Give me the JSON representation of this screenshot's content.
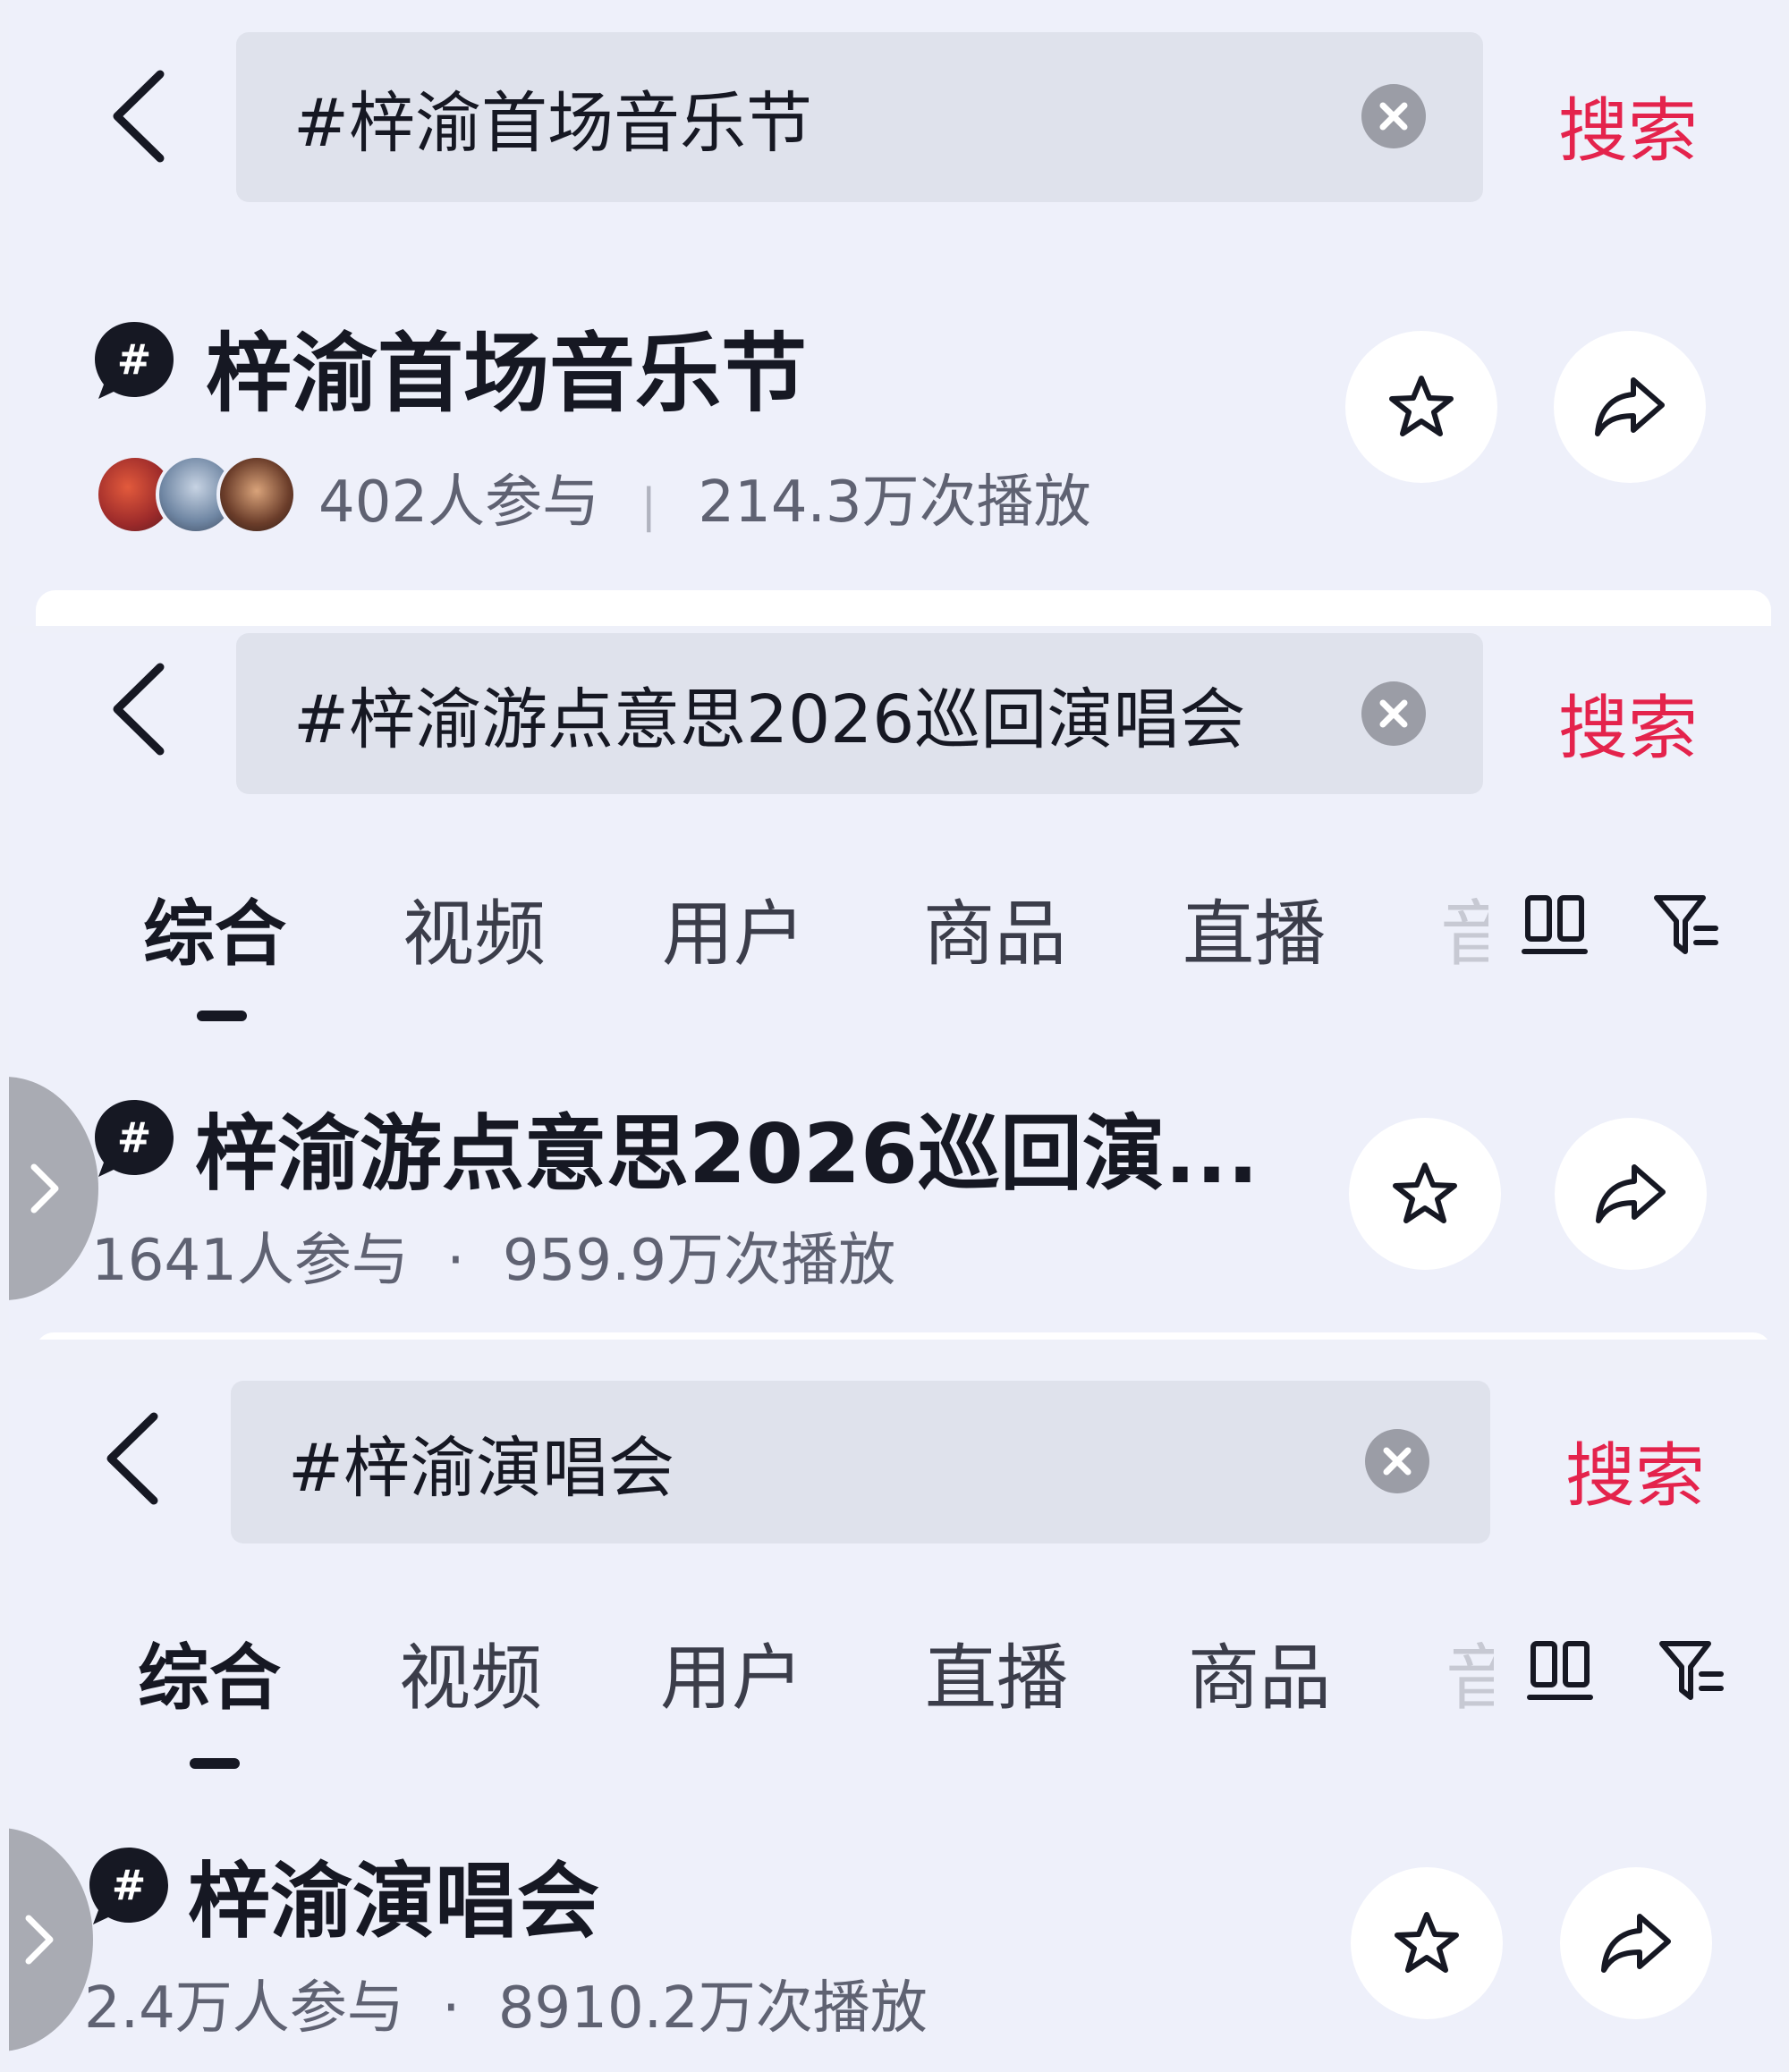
{
  "panels": [
    {
      "search_query": "#梓渝首场音乐节",
      "search_button": "搜索",
      "topic_title": "梓渝首场音乐节",
      "participants": "402人参与",
      "stat_separator": "|",
      "plays": "214.3万次播放"
    },
    {
      "search_query": "#梓渝游点意思2026巡回演唱会",
      "search_button": "搜索",
      "tabs": [
        "综合",
        "视频",
        "用户",
        "商品",
        "直播"
      ],
      "tab_partial": "音",
      "active_tab": "综合",
      "topic_title": "梓渝游点意思2026巡回演...",
      "participants": "1641人参与",
      "stat_separator": "·",
      "plays": "959.9万次播放"
    },
    {
      "search_query": "#梓渝演唱会",
      "search_button": "搜索",
      "tabs": [
        "综合",
        "视频",
        "用户",
        "直播",
        "商品"
      ],
      "tab_partial": "音",
      "active_tab": "综合",
      "topic_title": "梓渝演唱会",
      "participants": "2.4万人参与",
      "stat_separator": "·",
      "plays": "8910.2万次播放"
    }
  ],
  "colors": {
    "background": "#eef0fa",
    "search_accent": "#e4234c",
    "search_box": "#dfe2ec",
    "text_primary": "#161823",
    "text_secondary": "#5f6272"
  },
  "icons": [
    "back-arrow-icon",
    "clear-icon",
    "hashtag-icon",
    "star-icon",
    "share-icon",
    "grid-view-icon",
    "filter-icon",
    "chevron-right-icon"
  ]
}
